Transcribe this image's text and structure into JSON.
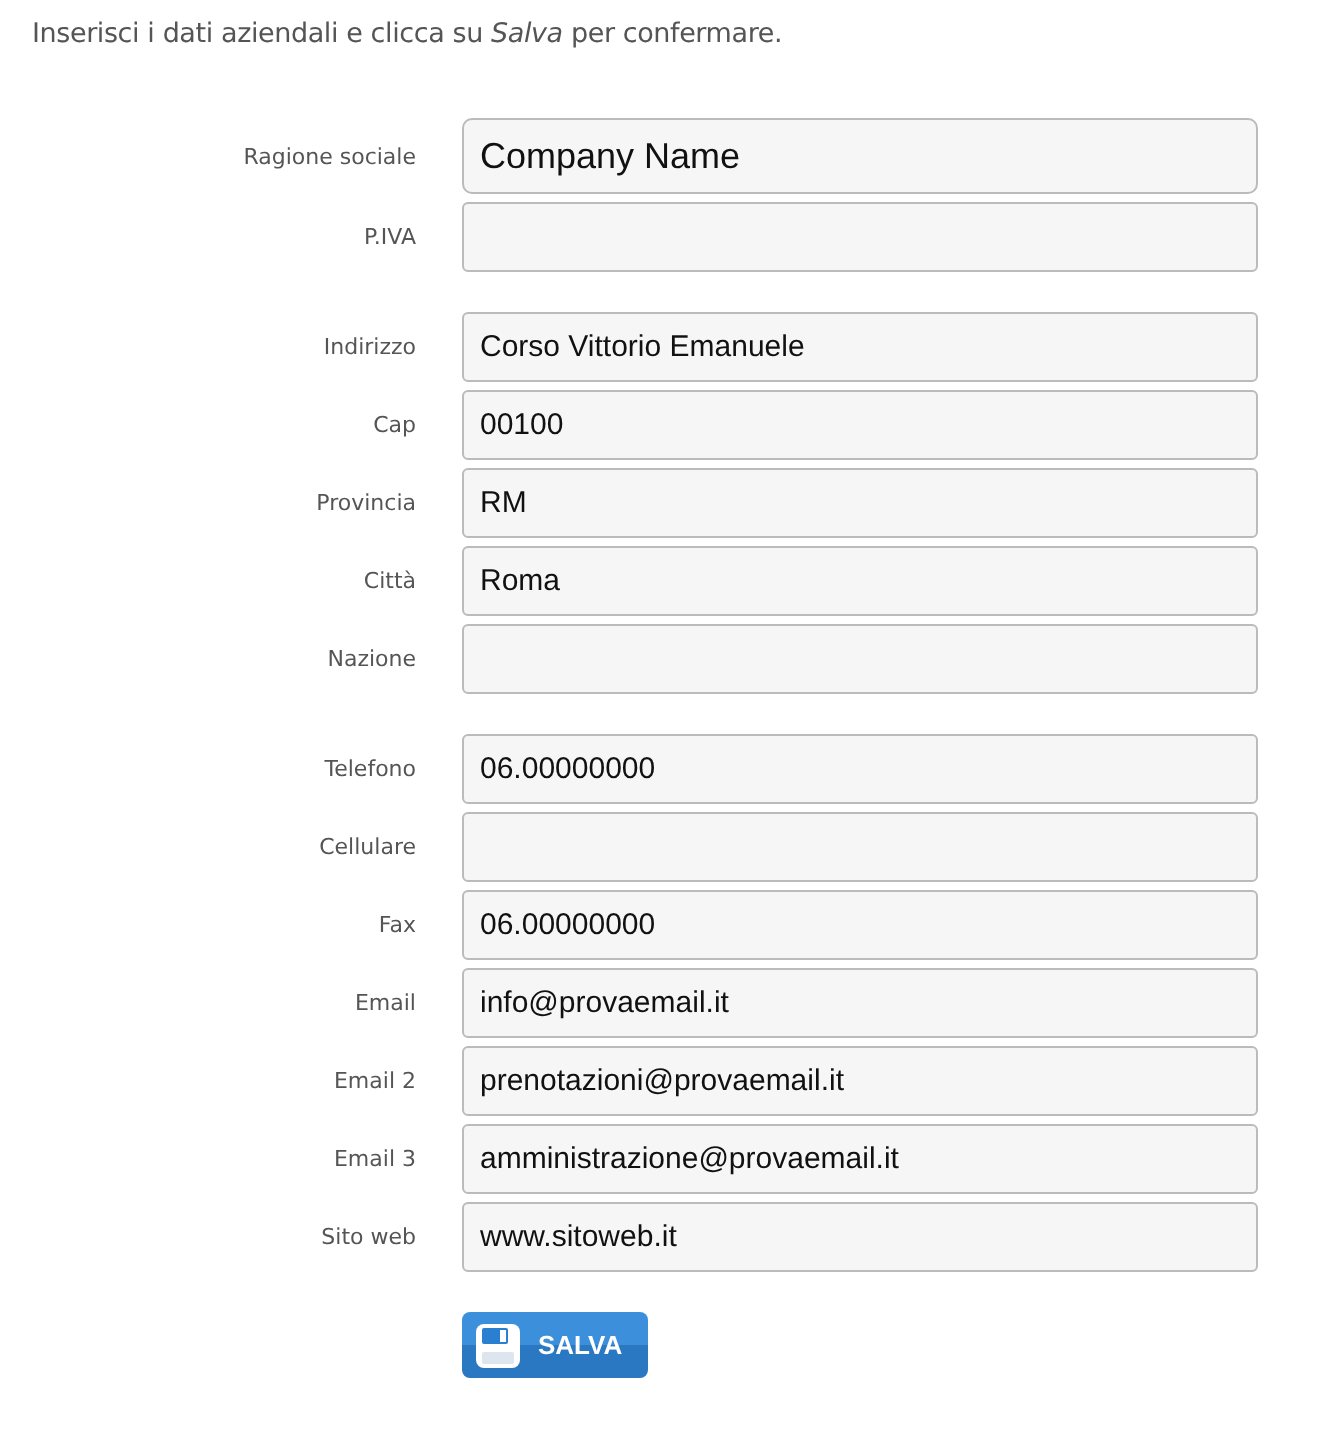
{
  "intro": "Inserisci i dati aziendali e clicca su *Salva* per confermare.",
  "groups": [
    {
      "fields": [
        {
          "label": "Ragione sociale",
          "value": "Company Name",
          "kind": "large"
        },
        {
          "label": "P.IVA",
          "kind": "normal"
        }
      ]
    },
    {
      "fields": [
        {
          "label": "Indirizzo",
          "value": "Corso Vittorio Emanuele",
          "kind": "normal"
        },
        {
          "label": "Cap",
          "value": "00100",
          "kind": "normal"
        },
        {
          "label": "Provincia",
          "value": "RM",
          "kind": "normal"
        },
        {
          "label": "Città",
          "value": "Roma",
          "kind": "normal"
        },
        {
          "label": "Nazione",
          "kind": "normal"
        }
      ]
    },
    {
      "fields": [
        {
          "label": "Telefono",
          "value": "06.00000000",
          "kind": "normal"
        },
        {
          "label": "Cellulare",
          "kind": "normal"
        },
        {
          "label": "Fax",
          "value": "06.00000000",
          "kind": "normal"
        },
        {
          "label": "Email",
          "value": "info@provaemail.it",
          "kind": "normal"
        },
        {
          "label": "Email 2",
          "value": "prenotazioni@provaemail.it",
          "kind": "normal"
        },
        {
          "label": "Email 3",
          "value": "amministrazione@provaemail.it",
          "kind": "normal"
        },
        {
          "label": "Sito web",
          "value": "www.sitoweb.it",
          "kind": "normal"
        }
      ]
    }
  ],
  "save_button": {
    "label": "SALVA"
  }
}
